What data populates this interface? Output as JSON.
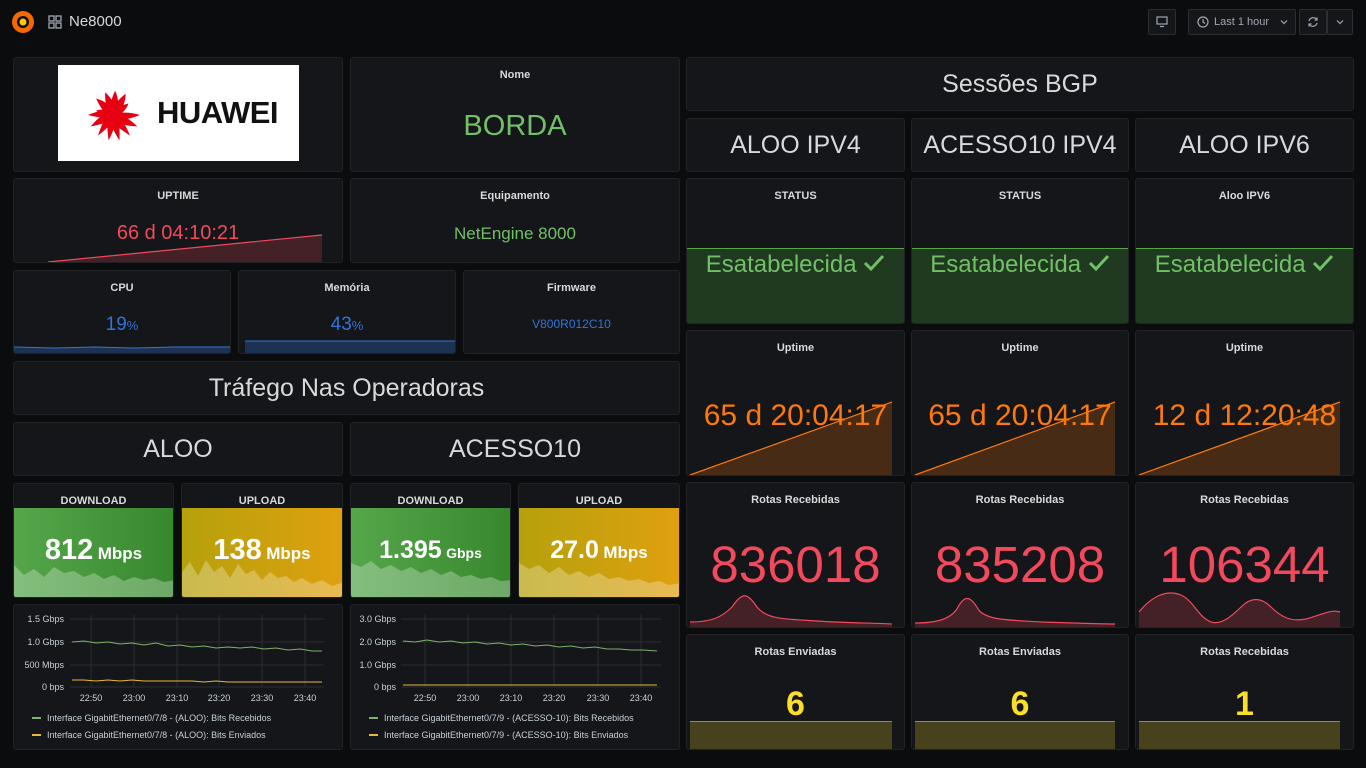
{
  "header": {
    "title": "Ne8000",
    "time_range": "Last 1 hour"
  },
  "logo_panel": {
    "brand": "HUAWEI"
  },
  "nome": {
    "title": "Nome",
    "value": "BORDA"
  },
  "uptime": {
    "title": "UPTIME",
    "value": "66 d 04:10:21"
  },
  "equipamento": {
    "title": "Equipamento",
    "value": "NetEngine 8000"
  },
  "cpu": {
    "title": "CPU",
    "value": "19",
    "unit": "%"
  },
  "memoria": {
    "title": "Memória",
    "value": "43",
    "unit": "%"
  },
  "firmware": {
    "title": "Firmware",
    "value": "V800R012C10"
  },
  "trafego_title": "Tráfego Nas Operadoras",
  "operators": [
    {
      "name": "ALOO",
      "download": {
        "title": "DOWNLOAD",
        "value": "812",
        "unit": "Mbps"
      },
      "upload": {
        "title": "UPLOAD",
        "value": "138",
        "unit": "Mbps"
      },
      "graph": {
        "y_ticks": [
          "1.5 Gbps",
          "1.0 Gbps",
          "500 Mbps",
          "0 bps"
        ],
        "x_ticks": [
          "22:50",
          "23:00",
          "23:10",
          "23:20",
          "23:30",
          "23:40"
        ],
        "legend": [
          "Interface GigabitEthernet0/7/8 - (ALOO): Bits Recebidos",
          "Interface GigabitEthernet0/7/8 - (ALOO): Bits Enviados"
        ]
      }
    },
    {
      "name": "ACESSO10",
      "download": {
        "title": "DOWNLOAD",
        "value": "1.395",
        "unit": "Gbps"
      },
      "upload": {
        "title": "UPLOAD",
        "value": "27.0",
        "unit": "Mbps"
      },
      "graph": {
        "y_ticks": [
          "3.0 Gbps",
          "2.0 Gbps",
          "1.0 Gbps",
          "0 bps"
        ],
        "x_ticks": [
          "22:50",
          "23:00",
          "23:10",
          "23:20",
          "23:30",
          "23:40"
        ],
        "legend": [
          "Interface GigabitEthernet0/7/9 - (ACESSO-10): Bits Recebidos",
          "Interface GigabitEthernet0/7/9 - (ACESSO-10): Bits Enviados"
        ]
      }
    }
  ],
  "bgp": {
    "title": "Sessões BGP",
    "sessions": [
      {
        "name": "ALOO IPV4",
        "status_title": "STATUS",
        "status": "Esatabelecida",
        "uptime_title": "Uptime",
        "uptime": "65 d 20:04:17",
        "recv_title": "Rotas Recebidas",
        "recv": "836018",
        "sent_title": "Rotas Enviadas",
        "sent": "6"
      },
      {
        "name": "ACESSO10 IPV4",
        "status_title": "STATUS",
        "status": "Esatabelecida",
        "uptime_title": "Uptime",
        "uptime": "65 d 20:04:17",
        "recv_title": "Rotas Recebidas",
        "recv": "835208",
        "sent_title": "Rotas Enviadas",
        "sent": "6"
      },
      {
        "name": "ALOO IPV6",
        "status_title": "Aloo IPV6",
        "status": "Esatabelecida",
        "uptime_title": "Uptime",
        "uptime": "12 d 12:20:48",
        "recv_title": "Rotas Recebidas",
        "recv": "106344",
        "sent_title": "Rotas Recebidas",
        "sent": "1"
      }
    ]
  },
  "colors": {
    "green": "#73bf69",
    "red": "#f2495c",
    "orange": "#ff780a",
    "yellow": "#fade2a",
    "blue": "#3274d9"
  }
}
